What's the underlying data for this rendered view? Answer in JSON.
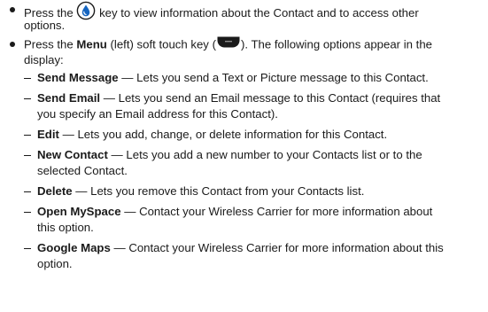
{
  "items": [
    {
      "line1_pre": "Press the",
      "icon": "info-key-icon",
      "line1_post": "key to view information about the Contact and to access other",
      "line2": "options."
    },
    {
      "line1_pre": "Press the",
      "bold": "Menu",
      "line1_mid": "(left) soft touch key (",
      "icon": "menu-soft-key-icon",
      "line1_post": "). The following options appear in the",
      "line2": "display:"
    }
  ],
  "options": [
    {
      "name": "Send Message",
      "desc_line1": "— Lets you send a Text or Picture message to this Contact."
    },
    {
      "name": "Send Email",
      "desc_line1": "— Lets you send an Email message to this Contact (requires that",
      "desc_line2": "you specify an Email address for this Contact)."
    },
    {
      "name": "Edit",
      "desc_line1": "— Lets you add, change, or delete information for this Contact."
    },
    {
      "name": "New Contact",
      "desc_line1": "— Lets you add a new number to your Contacts list or to the",
      "desc_line2": "selected Contact."
    },
    {
      "name": "Delete",
      "desc_line1": "— Lets you remove this Contact from your Contacts list."
    },
    {
      "name": "Open MySpace",
      "desc_line1": "— Contact your Wireless Carrier for more information about",
      "desc_line2": "this option."
    },
    {
      "name": "Google Maps",
      "desc_line1": "— Contact your Wireless Carrier for more information about this",
      "desc_line2": "option."
    }
  ],
  "colors": {
    "text": "#1a1a1a",
    "icon_blue": "#1565c0"
  }
}
